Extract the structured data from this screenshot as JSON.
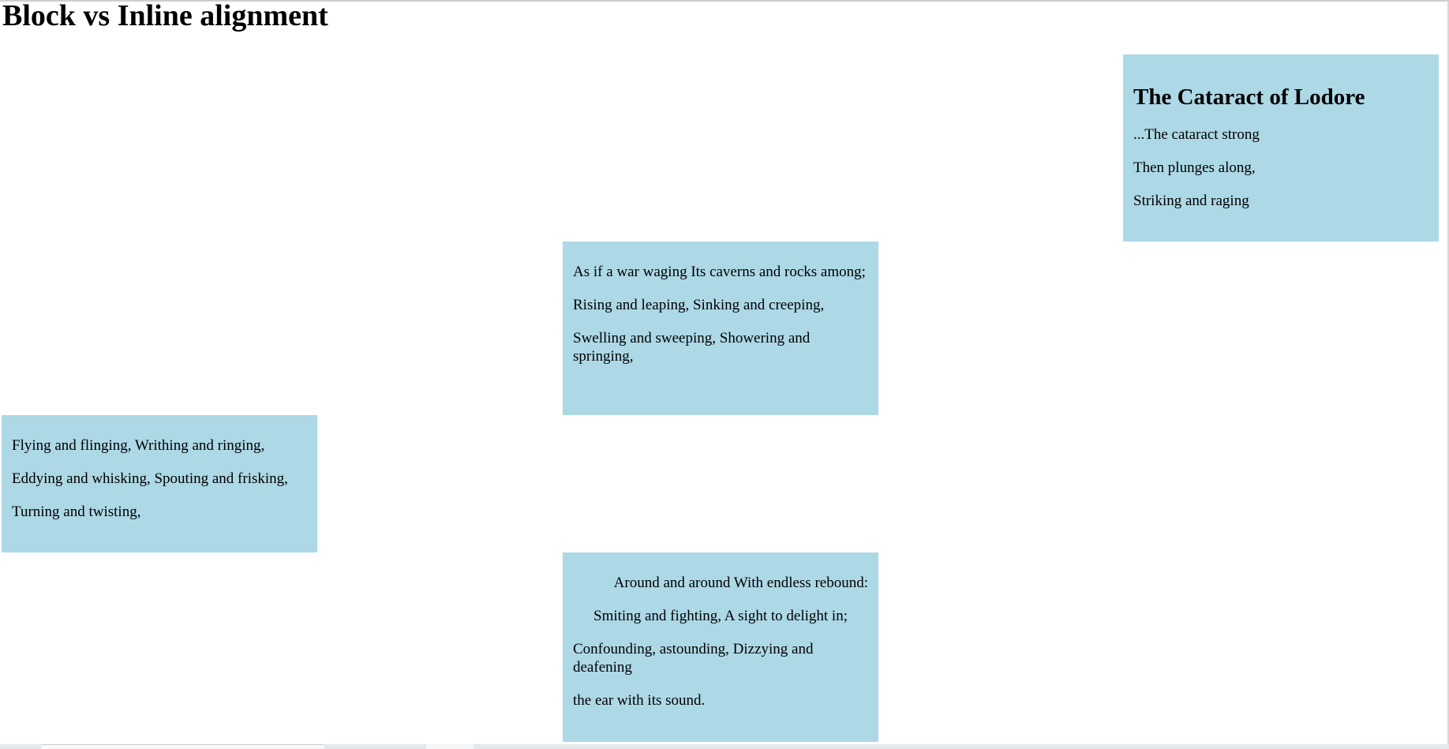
{
  "page": {
    "title": "Block vs Inline alignment"
  },
  "colors": {
    "box_background": "#add8e6",
    "page_background": "#ffffff",
    "text": "#000000"
  },
  "boxes": {
    "right": {
      "heading": "The Cataract of Lodore",
      "lines": [
        "...The cataract strong",
        "Then plunges along,",
        "Striking and raging"
      ]
    },
    "center": {
      "lines": [
        "As if a war waging Its caverns and rocks among;",
        "Rising and leaping, Sinking and creeping,",
        "Swelling and sweeping, Showering and springing,"
      ]
    },
    "left": {
      "lines": [
        "Flying and flinging, Writhing and ringing,",
        "Eddying and whisking, Spouting and frisking,",
        "Turning and twisting,"
      ]
    },
    "bottom": {
      "lines": [
        "Around and around With endless rebound:",
        "Smiting and fighting, A sight to delight in;",
        "Confounding, astounding, Dizzying and deafening",
        "the ear with its sound."
      ]
    }
  }
}
